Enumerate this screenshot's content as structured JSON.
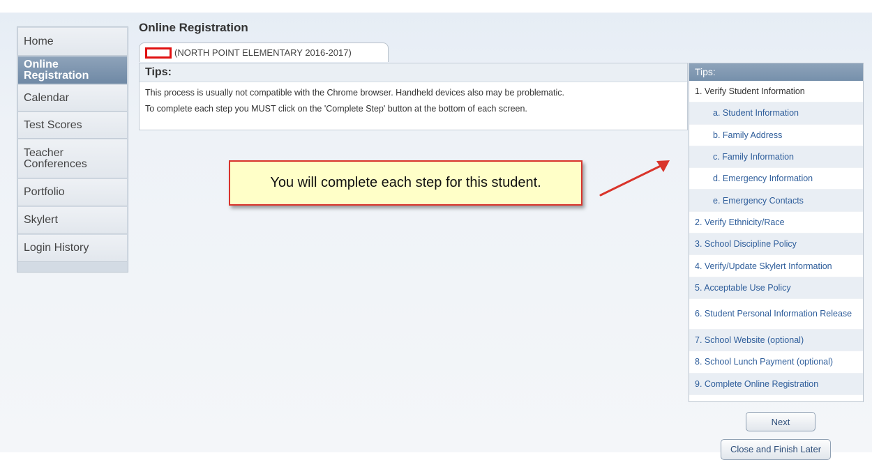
{
  "sidebar": {
    "items": [
      {
        "label": "Home"
      },
      {
        "label": "Online Registration"
      },
      {
        "label": "Calendar"
      },
      {
        "label": "Test Scores"
      },
      {
        "label": "Teacher Conferences"
      },
      {
        "label": "Portfolio"
      },
      {
        "label": "Skylert"
      },
      {
        "label": "Login History"
      }
    ]
  },
  "page": {
    "title": "Online Registration",
    "student_tab": "(NORTH POINT ELEMENTARY 2016-2017)"
  },
  "tips": {
    "header": "Tips:",
    "lines": [
      "This process is usually not compatible with the Chrome browser. Handheld devices also may be problematic.",
      "To complete each step you MUST click on the 'Complete Step' button at the bottom of each screen."
    ]
  },
  "callout": {
    "text": "You will complete each step for this student."
  },
  "steps": {
    "header": "Tips:",
    "items": [
      "1. Verify Student Information",
      "a. Student Information",
      "b. Family Address",
      "c. Family Information",
      "d. Emergency Information",
      "e. Emergency Contacts",
      "2. Verify Ethnicity/Race",
      "3. School Discipline Policy",
      "4. Verify/Update Skylert Information",
      "5. Acceptable Use Policy",
      "6. Student Personal Information Release",
      "7. School Website (optional)",
      "8. School Lunch Payment (optional)",
      "9. Complete Online Registration"
    ]
  },
  "buttons": {
    "next": "Next",
    "close": "Close and Finish Later"
  },
  "colors": {
    "active_nav": "#7a92ad",
    "callout_border": "#d9342b",
    "callout_fill": "#ffffc8",
    "link": "#2f5e9b"
  }
}
